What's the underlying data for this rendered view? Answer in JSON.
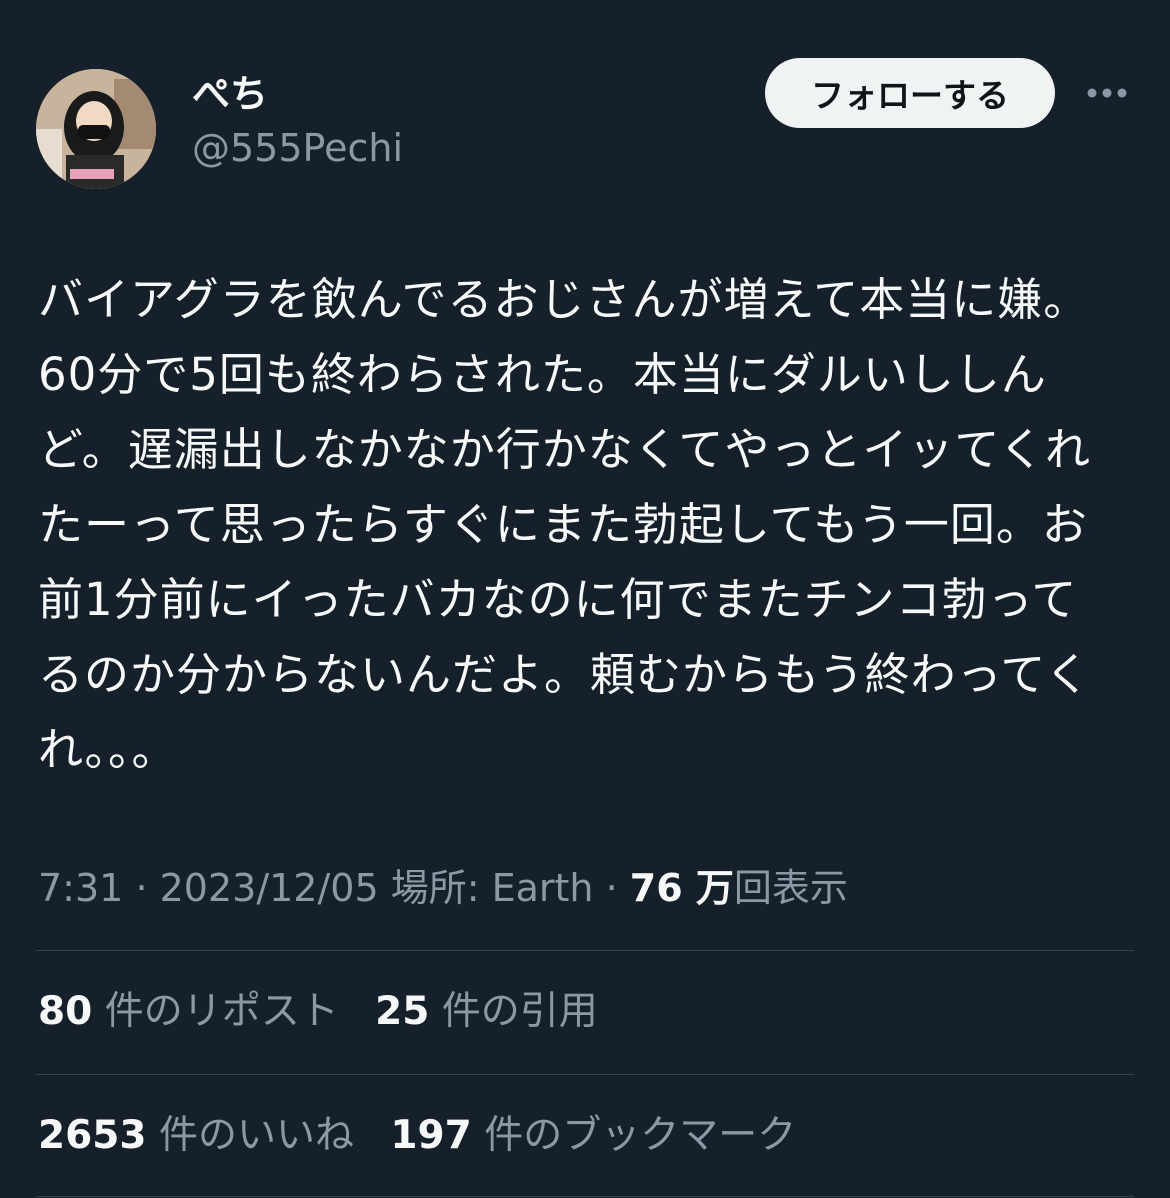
{
  "user": {
    "display_name": "ぺち",
    "handle": "@555Pechi"
  },
  "follow_button": {
    "label": "フォローする"
  },
  "more_button": {
    "icon": "more-horizontal-icon"
  },
  "tweet": {
    "text": "バイアグラを飲んでるおじさんが増えて本当に嫌。\n60分で5回も終わらされた。本当にダルいししん\nど。遅漏出しなかなか行かなくてやっとイッてくれ\nたーって思ったらすぐにまた勃起してもう一回。お\n前1分前にイったバカなのに何でまたチンコ勃って\nるのか分からないんだよ。頼むからもう終わってく\nれ。。。"
  },
  "meta": {
    "time": "7:31",
    "date": "2023/12/05",
    "location_label": "場所: Earth",
    "views_count": "76 万",
    "views_label": "回表示"
  },
  "stats": {
    "reposts_count": "80",
    "reposts_label": "件のリポスト",
    "quotes_count": "25",
    "quotes_label": "件の引用",
    "likes_count": "2653",
    "likes_label": "件のいいね",
    "bookmarks_count": "197",
    "bookmarks_label": "件のブックマーク"
  },
  "colors": {
    "background": "#15202b",
    "text_primary": "#f7f9f9",
    "text_secondary": "#8b98a5",
    "divider": "#38444d",
    "button_bg": "#eff3f4"
  }
}
